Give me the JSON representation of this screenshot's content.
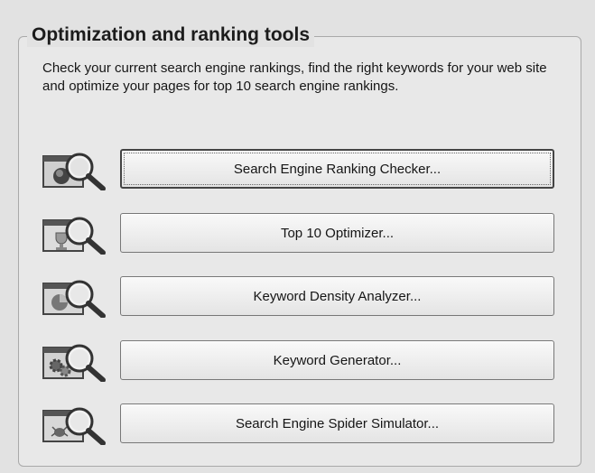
{
  "group": {
    "title": "Optimization and ranking tools",
    "description": "Check your current search engine rankings, find the right keywords for your web site and optimize your pages for top 10 search engine rankings."
  },
  "tools": [
    {
      "label": "Search Engine Ranking Checker...",
      "icon": "magnifier-globe-icon"
    },
    {
      "label": "Top 10 Optimizer...",
      "icon": "magnifier-trophy-icon"
    },
    {
      "label": "Keyword Density Analyzer...",
      "icon": "magnifier-pie-chart-icon"
    },
    {
      "label": "Keyword Generator...",
      "icon": "magnifier-gears-icon"
    },
    {
      "label": "Search Engine Spider Simulator...",
      "icon": "magnifier-spider-icon"
    }
  ]
}
